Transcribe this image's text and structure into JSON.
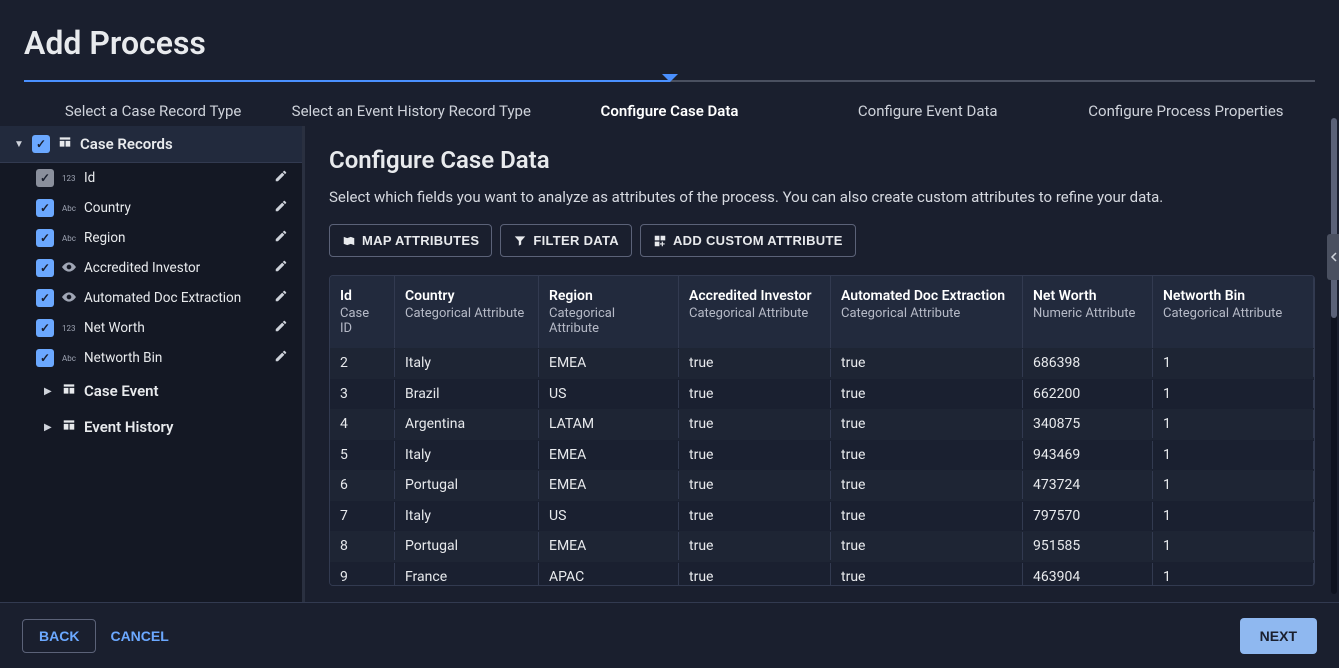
{
  "header": {
    "title": "Add Process"
  },
  "stepper": {
    "steps": [
      {
        "label": "Select a Case Record Type"
      },
      {
        "label": "Select an Event History Record Type"
      },
      {
        "label": "Configure Case Data"
      },
      {
        "label": "Configure Event Data"
      },
      {
        "label": "Configure Process Properties"
      }
    ],
    "active_index": 2
  },
  "sidebar": {
    "group": {
      "label": "Case Records"
    },
    "fields": [
      {
        "label": "Id",
        "type_glyph": "123",
        "editable": true,
        "locked": true
      },
      {
        "label": "Country",
        "type_glyph": "Abc",
        "editable": true,
        "locked": false
      },
      {
        "label": "Region",
        "type_glyph": "Abc",
        "editable": true,
        "locked": false
      },
      {
        "label": "Accredited Investor",
        "type_glyph": "👁",
        "editable": true,
        "locked": false
      },
      {
        "label": "Automated Doc Extraction",
        "type_glyph": "👁",
        "editable": true,
        "locked": false
      },
      {
        "label": "Net Worth",
        "type_glyph": "123",
        "editable": true,
        "locked": false
      },
      {
        "label": "Networth Bin",
        "type_glyph": "Abc",
        "editable": true,
        "locked": false
      }
    ],
    "subgroups": [
      {
        "label": "Case Event"
      },
      {
        "label": "Event History"
      }
    ]
  },
  "main": {
    "title": "Configure Case Data",
    "description": "Select which fields you want to analyze as attributes of the process. You can also create custom attributes to refine your data.",
    "buttons": {
      "map": "MAP ATTRIBUTES",
      "filter": "FILTER DATA",
      "add": "ADD CUSTOM ATTRIBUTE"
    },
    "columns": [
      {
        "name": "Id",
        "sub": "Case ID"
      },
      {
        "name": "Country",
        "sub": "Categorical Attribute"
      },
      {
        "name": "Region",
        "sub": "Categorical Attribute"
      },
      {
        "name": "Accredited Investor",
        "sub": "Categorical Attribute"
      },
      {
        "name": "Automated Doc Extraction",
        "sub": "Categorical Attribute"
      },
      {
        "name": "Net Worth",
        "sub": "Numeric Attribute"
      },
      {
        "name": "Networth Bin",
        "sub": "Categorical Attribute"
      }
    ],
    "rows": [
      {
        "id": "2",
        "country": "Italy",
        "region": "EMEA",
        "acc": "true",
        "auto": "true",
        "net": "686398",
        "bin": "1"
      },
      {
        "id": "3",
        "country": "Brazil",
        "region": "US",
        "acc": "true",
        "auto": "true",
        "net": "662200",
        "bin": "1"
      },
      {
        "id": "4",
        "country": "Argentina",
        "region": "LATAM",
        "acc": "true",
        "auto": "true",
        "net": "340875",
        "bin": "1"
      },
      {
        "id": "5",
        "country": "Italy",
        "region": "EMEA",
        "acc": "true",
        "auto": "true",
        "net": "943469",
        "bin": "1"
      },
      {
        "id": "6",
        "country": "Portugal",
        "region": "EMEA",
        "acc": "true",
        "auto": "true",
        "net": "473724",
        "bin": "1"
      },
      {
        "id": "7",
        "country": "Italy",
        "region": "US",
        "acc": "true",
        "auto": "true",
        "net": "797570",
        "bin": "1"
      },
      {
        "id": "8",
        "country": "Portugal",
        "region": "EMEA",
        "acc": "true",
        "auto": "true",
        "net": "951585",
        "bin": "1"
      },
      {
        "id": "9",
        "country": "France",
        "region": "APAC",
        "acc": "true",
        "auto": "true",
        "net": "463904",
        "bin": "1"
      }
    ]
  },
  "footer": {
    "back": "BACK",
    "cancel": "CANCEL",
    "next": "NEXT"
  }
}
